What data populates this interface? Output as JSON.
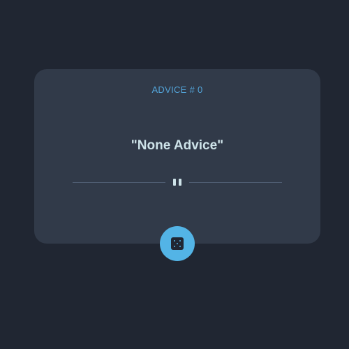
{
  "card": {
    "advice_label": "ADVICE # 0",
    "advice_text": "\"None Advice\""
  },
  "divider": {
    "icon": "pause-icon"
  },
  "dice_button": {
    "icon": "dice-icon"
  },
  "colors": {
    "background": "#202632",
    "card": "#313a49",
    "accent_text": "#53a4d9",
    "button": "#53b4e6",
    "quote_text": "#ffffff",
    "divider_line": "#4f5d73"
  }
}
